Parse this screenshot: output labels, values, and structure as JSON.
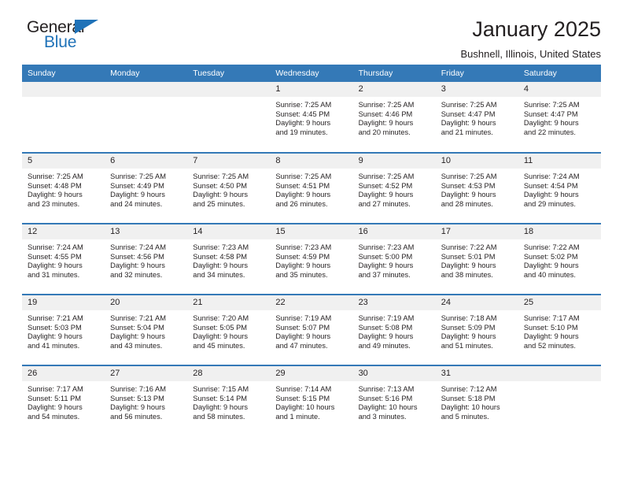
{
  "brand": {
    "name_top": "General",
    "name_bottom": "Blue",
    "color_dark": "#231f20",
    "color_blue": "#1f72b8"
  },
  "header": {
    "title": "January 2025",
    "subtitle": "Bushnell, Illinois, United States"
  },
  "theme": {
    "header_bg": "#3479b7",
    "daynum_bg": "#f0f0f0",
    "text": "#231f20"
  },
  "weekday_headers": [
    "Sunday",
    "Monday",
    "Tuesday",
    "Wednesday",
    "Thursday",
    "Friday",
    "Saturday"
  ],
  "weeks": [
    [
      {
        "day": "",
        "sunrise": "",
        "sunset": "",
        "daylight_1": "",
        "daylight_2": ""
      },
      {
        "day": "",
        "sunrise": "",
        "sunset": "",
        "daylight_1": "",
        "daylight_2": ""
      },
      {
        "day": "",
        "sunrise": "",
        "sunset": "",
        "daylight_1": "",
        "daylight_2": ""
      },
      {
        "day": "1",
        "sunrise": "Sunrise: 7:25 AM",
        "sunset": "Sunset: 4:45 PM",
        "daylight_1": "Daylight: 9 hours",
        "daylight_2": "and 19 minutes."
      },
      {
        "day": "2",
        "sunrise": "Sunrise: 7:25 AM",
        "sunset": "Sunset: 4:46 PM",
        "daylight_1": "Daylight: 9 hours",
        "daylight_2": "and 20 minutes."
      },
      {
        "day": "3",
        "sunrise": "Sunrise: 7:25 AM",
        "sunset": "Sunset: 4:47 PM",
        "daylight_1": "Daylight: 9 hours",
        "daylight_2": "and 21 minutes."
      },
      {
        "day": "4",
        "sunrise": "Sunrise: 7:25 AM",
        "sunset": "Sunset: 4:47 PM",
        "daylight_1": "Daylight: 9 hours",
        "daylight_2": "and 22 minutes."
      }
    ],
    [
      {
        "day": "5",
        "sunrise": "Sunrise: 7:25 AM",
        "sunset": "Sunset: 4:48 PM",
        "daylight_1": "Daylight: 9 hours",
        "daylight_2": "and 23 minutes."
      },
      {
        "day": "6",
        "sunrise": "Sunrise: 7:25 AM",
        "sunset": "Sunset: 4:49 PM",
        "daylight_1": "Daylight: 9 hours",
        "daylight_2": "and 24 minutes."
      },
      {
        "day": "7",
        "sunrise": "Sunrise: 7:25 AM",
        "sunset": "Sunset: 4:50 PM",
        "daylight_1": "Daylight: 9 hours",
        "daylight_2": "and 25 minutes."
      },
      {
        "day": "8",
        "sunrise": "Sunrise: 7:25 AM",
        "sunset": "Sunset: 4:51 PM",
        "daylight_1": "Daylight: 9 hours",
        "daylight_2": "and 26 minutes."
      },
      {
        "day": "9",
        "sunrise": "Sunrise: 7:25 AM",
        "sunset": "Sunset: 4:52 PM",
        "daylight_1": "Daylight: 9 hours",
        "daylight_2": "and 27 minutes."
      },
      {
        "day": "10",
        "sunrise": "Sunrise: 7:25 AM",
        "sunset": "Sunset: 4:53 PM",
        "daylight_1": "Daylight: 9 hours",
        "daylight_2": "and 28 minutes."
      },
      {
        "day": "11",
        "sunrise": "Sunrise: 7:24 AM",
        "sunset": "Sunset: 4:54 PM",
        "daylight_1": "Daylight: 9 hours",
        "daylight_2": "and 29 minutes."
      }
    ],
    [
      {
        "day": "12",
        "sunrise": "Sunrise: 7:24 AM",
        "sunset": "Sunset: 4:55 PM",
        "daylight_1": "Daylight: 9 hours",
        "daylight_2": "and 31 minutes."
      },
      {
        "day": "13",
        "sunrise": "Sunrise: 7:24 AM",
        "sunset": "Sunset: 4:56 PM",
        "daylight_1": "Daylight: 9 hours",
        "daylight_2": "and 32 minutes."
      },
      {
        "day": "14",
        "sunrise": "Sunrise: 7:23 AM",
        "sunset": "Sunset: 4:58 PM",
        "daylight_1": "Daylight: 9 hours",
        "daylight_2": "and 34 minutes."
      },
      {
        "day": "15",
        "sunrise": "Sunrise: 7:23 AM",
        "sunset": "Sunset: 4:59 PM",
        "daylight_1": "Daylight: 9 hours",
        "daylight_2": "and 35 minutes."
      },
      {
        "day": "16",
        "sunrise": "Sunrise: 7:23 AM",
        "sunset": "Sunset: 5:00 PM",
        "daylight_1": "Daylight: 9 hours",
        "daylight_2": "and 37 minutes."
      },
      {
        "day": "17",
        "sunrise": "Sunrise: 7:22 AM",
        "sunset": "Sunset: 5:01 PM",
        "daylight_1": "Daylight: 9 hours",
        "daylight_2": "and 38 minutes."
      },
      {
        "day": "18",
        "sunrise": "Sunrise: 7:22 AM",
        "sunset": "Sunset: 5:02 PM",
        "daylight_1": "Daylight: 9 hours",
        "daylight_2": "and 40 minutes."
      }
    ],
    [
      {
        "day": "19",
        "sunrise": "Sunrise: 7:21 AM",
        "sunset": "Sunset: 5:03 PM",
        "daylight_1": "Daylight: 9 hours",
        "daylight_2": "and 41 minutes."
      },
      {
        "day": "20",
        "sunrise": "Sunrise: 7:21 AM",
        "sunset": "Sunset: 5:04 PM",
        "daylight_1": "Daylight: 9 hours",
        "daylight_2": "and 43 minutes."
      },
      {
        "day": "21",
        "sunrise": "Sunrise: 7:20 AM",
        "sunset": "Sunset: 5:05 PM",
        "daylight_1": "Daylight: 9 hours",
        "daylight_2": "and 45 minutes."
      },
      {
        "day": "22",
        "sunrise": "Sunrise: 7:19 AM",
        "sunset": "Sunset: 5:07 PM",
        "daylight_1": "Daylight: 9 hours",
        "daylight_2": "and 47 minutes."
      },
      {
        "day": "23",
        "sunrise": "Sunrise: 7:19 AM",
        "sunset": "Sunset: 5:08 PM",
        "daylight_1": "Daylight: 9 hours",
        "daylight_2": "and 49 minutes."
      },
      {
        "day": "24",
        "sunrise": "Sunrise: 7:18 AM",
        "sunset": "Sunset: 5:09 PM",
        "daylight_1": "Daylight: 9 hours",
        "daylight_2": "and 51 minutes."
      },
      {
        "day": "25",
        "sunrise": "Sunrise: 7:17 AM",
        "sunset": "Sunset: 5:10 PM",
        "daylight_1": "Daylight: 9 hours",
        "daylight_2": "and 52 minutes."
      }
    ],
    [
      {
        "day": "26",
        "sunrise": "Sunrise: 7:17 AM",
        "sunset": "Sunset: 5:11 PM",
        "daylight_1": "Daylight: 9 hours",
        "daylight_2": "and 54 minutes."
      },
      {
        "day": "27",
        "sunrise": "Sunrise: 7:16 AM",
        "sunset": "Sunset: 5:13 PM",
        "daylight_1": "Daylight: 9 hours",
        "daylight_2": "and 56 minutes."
      },
      {
        "day": "28",
        "sunrise": "Sunrise: 7:15 AM",
        "sunset": "Sunset: 5:14 PM",
        "daylight_1": "Daylight: 9 hours",
        "daylight_2": "and 58 minutes."
      },
      {
        "day": "29",
        "sunrise": "Sunrise: 7:14 AM",
        "sunset": "Sunset: 5:15 PM",
        "daylight_1": "Daylight: 10 hours",
        "daylight_2": "and 1 minute."
      },
      {
        "day": "30",
        "sunrise": "Sunrise: 7:13 AM",
        "sunset": "Sunset: 5:16 PM",
        "daylight_1": "Daylight: 10 hours",
        "daylight_2": "and 3 minutes."
      },
      {
        "day": "31",
        "sunrise": "Sunrise: 7:12 AM",
        "sunset": "Sunset: 5:18 PM",
        "daylight_1": "Daylight: 10 hours",
        "daylight_2": "and 5 minutes."
      },
      {
        "day": "",
        "sunrise": "",
        "sunset": "",
        "daylight_1": "",
        "daylight_2": ""
      }
    ]
  ]
}
